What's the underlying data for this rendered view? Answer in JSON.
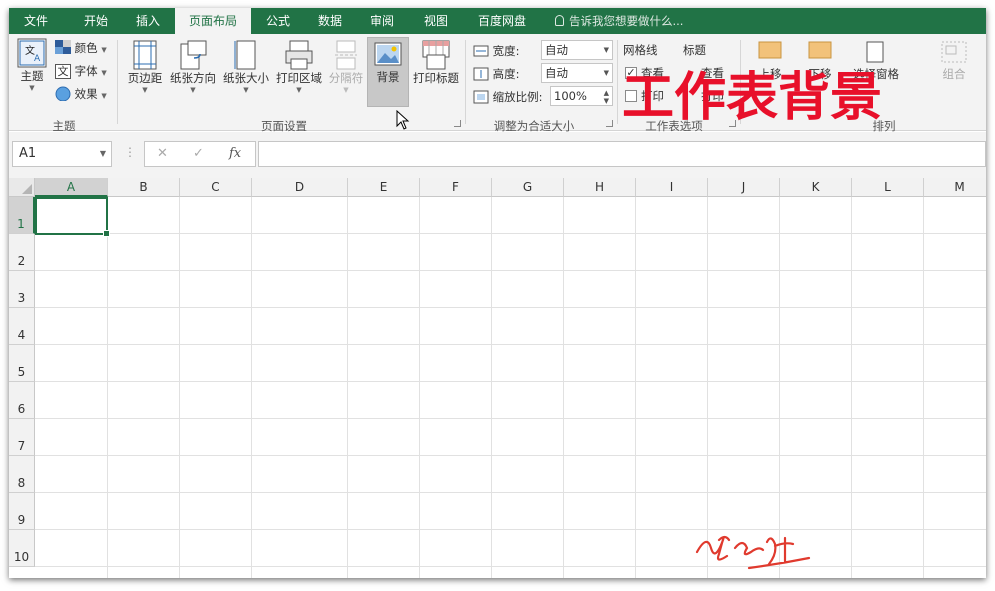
{
  "tabs": [
    {
      "label": "文件",
      "active": false
    },
    {
      "label": "开始",
      "active": false
    },
    {
      "label": "插入",
      "active": false
    },
    {
      "label": "页面布局",
      "active": true
    },
    {
      "label": "公式",
      "active": false
    },
    {
      "label": "数据",
      "active": false
    },
    {
      "label": "审阅",
      "active": false
    },
    {
      "label": "视图",
      "active": false
    },
    {
      "label": "百度网盘",
      "active": false
    }
  ],
  "tell_me": "告诉我您想要做什么...",
  "ribbon": {
    "themes": {
      "theme_label": "主题",
      "colors_label": "颜色",
      "fonts_label": "字体",
      "effects_label": "效果",
      "group_label": "主题"
    },
    "page_setup": {
      "margins_label": "页边距",
      "orientation_label": "纸张方向",
      "size_label": "纸张大小",
      "print_area_label": "打印区域",
      "breaks_label": "分隔符",
      "background_label": "背景",
      "print_titles_label": "打印标题",
      "group_label": "页面设置"
    },
    "scale_to_fit": {
      "width_label": "宽度:",
      "width_value": "自动",
      "height_label": "高度:",
      "height_value": "自动",
      "scale_label": "缩放比例:",
      "scale_value": "100%",
      "group_label": "调整为合适大小"
    },
    "sheet_options": {
      "gridlines_label": "网格线",
      "headings_label": "标题",
      "view_label": "查看",
      "print_label": "打印",
      "view_label_2": "查看",
      "print_label_2": "打印",
      "gridlines_view_checked": true,
      "gridlines_print_checked": false,
      "group_label": "工作表选项"
    },
    "arrange": {
      "up_label": "上移",
      "down_label": "下移",
      "pane_label": "选择窗格",
      "group_btn_label": "组合",
      "group_label": "排列"
    }
  },
  "overlay_title": "工作表背景",
  "formula_bar": {
    "name_box": "A1",
    "cancel_glyph": "✕",
    "enter_glyph": "✓",
    "fx_glyph": "fx",
    "formula_value": ""
  },
  "columns": [
    "A",
    "B",
    "C",
    "D",
    "E",
    "F",
    "G",
    "H",
    "I",
    "J",
    "K",
    "L",
    "M"
  ],
  "rows": [
    "1",
    "2",
    "3",
    "4",
    "5",
    "6",
    "7",
    "8",
    "9",
    "10"
  ],
  "active_cell": "A1",
  "colors": {
    "accent": "#217346",
    "overlay_title": "#e8102a",
    "signature": "#e03a2e"
  }
}
